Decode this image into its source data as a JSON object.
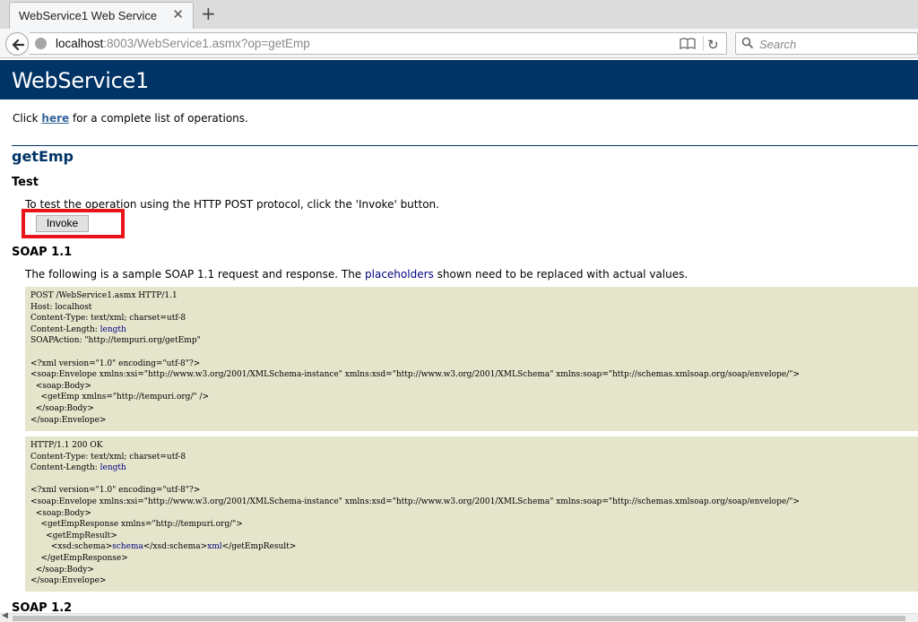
{
  "browser": {
    "tab_title": "WebService1 Web Service",
    "tab_close": "✕",
    "new_tab": "+",
    "url_host": "localhost",
    "url_rest": ":8003/WebService1.asmx?op=getEmp",
    "reload": "↻",
    "search_icon": "🔍",
    "search_placeholder": "Search"
  },
  "page": {
    "service_name": "WebService1",
    "intro": {
      "before": "Click ",
      "link": "here",
      "after": " for a complete list of operations."
    },
    "operation": "getEmp",
    "test": {
      "heading": "Test",
      "text": "To test the operation using the HTTP POST protocol, click the 'Invoke' button.",
      "invoke_label": "Invoke"
    },
    "soap11": {
      "heading": "SOAP 1.1",
      "desc_before": "The following is a sample SOAP 1.1 request and response. The ",
      "desc_link": "placeholders",
      "desc_after": " shown need to be replaced with actual values.",
      "request": [
        "POST /WebService1.asmx HTTP/1.1",
        "Host: localhost",
        [
          "Content-Type: text/xml; charset=utf-8"
        ],
        [
          "Content-Length: ",
          {
            "hl": "length"
          }
        ],
        "SOAPAction: \"http://tempuri.org/getEmp\"",
        "",
        "<?xml version=\"1.0\" encoding=\"utf-8\"?>",
        "<soap:Envelope xmlns:xsi=\"http://www.w3.org/2001/XMLSchema-instance\" xmlns:xsd=\"http://www.w3.org/2001/XMLSchema\" xmlns:soap=\"http://schemas.xmlsoap.org/soap/envelope/\">",
        "  <soap:Body>",
        "    <getEmp xmlns=\"http://tempuri.org/\" />",
        "  </soap:Body>",
        "</soap:Envelope>"
      ],
      "response": [
        "HTTP/1.1 200 OK",
        "Content-Type: text/xml; charset=utf-8",
        [
          "Content-Length: ",
          {
            "hl": "length"
          }
        ],
        "",
        "<?xml version=\"1.0\" encoding=\"utf-8\"?>",
        "<soap:Envelope xmlns:xsi=\"http://www.w3.org/2001/XMLSchema-instance\" xmlns:xsd=\"http://www.w3.org/2001/XMLSchema\" xmlns:soap=\"http://schemas.xmlsoap.org/soap/envelope/\">",
        "  <soap:Body>",
        "    <getEmpResponse xmlns=\"http://tempuri.org/\">",
        "      <getEmpResult>",
        [
          "        <xsd:schema>",
          {
            "hl": "schema"
          },
          "</xsd:schema>",
          {
            "hl": "xml"
          },
          "</getEmpResult>"
        ],
        "    </getEmpResponse>",
        "  </soap:Body>",
        "</soap:Envelope>"
      ]
    },
    "soap12": {
      "heading": "SOAP 1.2"
    }
  },
  "colors": {
    "header_bg": "#003366",
    "code_bg": "#e5e5cc",
    "highlight_border": "#e8141a",
    "placeholder_text": "#000080"
  }
}
